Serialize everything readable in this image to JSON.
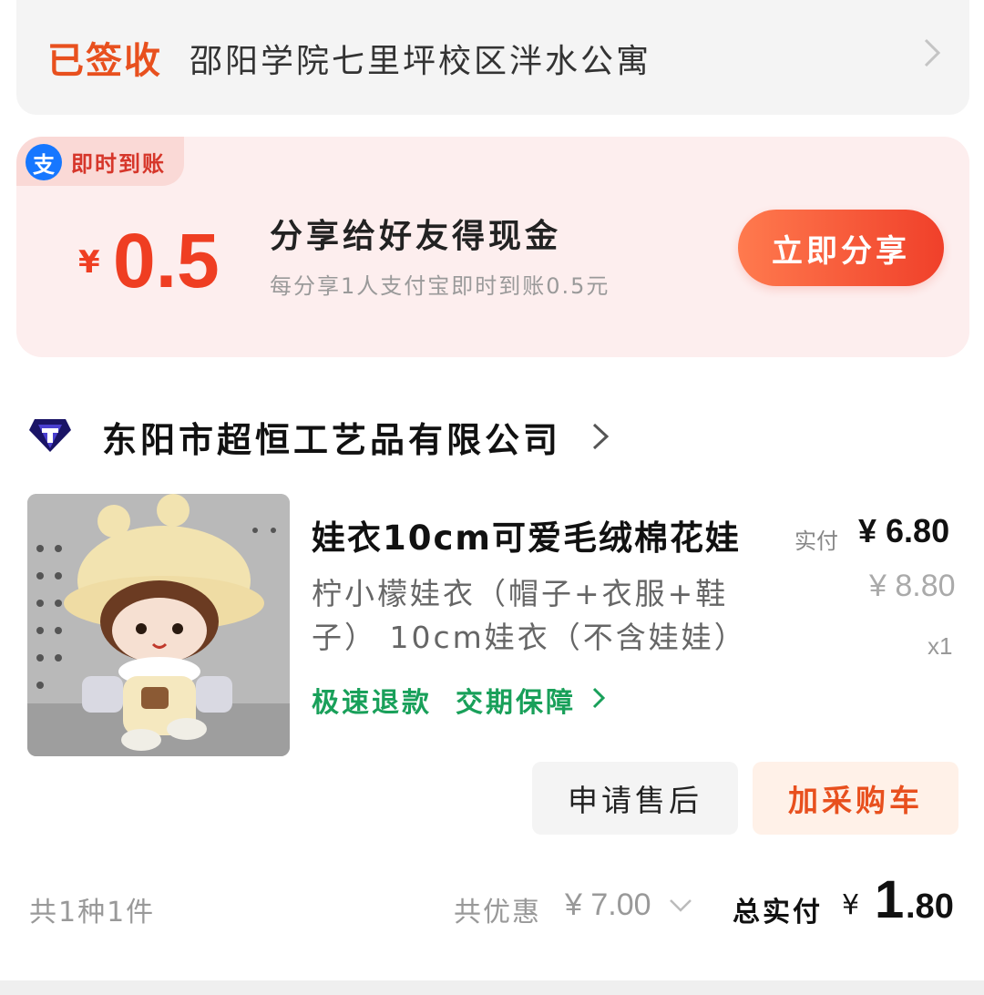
{
  "address": {
    "status": "已签收",
    "text": "邵阳学院七里坪校区泮水公寓"
  },
  "cashback": {
    "tag_icon": "支",
    "tag_text": "即时到账",
    "currency": "¥",
    "amount": "0.5",
    "title": "分享给好友得现金",
    "subtitle": "每分享1人支付宝即时到账0.5元",
    "button": "立即分享",
    "colors": {
      "accent": "#ef3e22",
      "background": "#fdeeee"
    }
  },
  "shop": {
    "name": "东阳市超恒工艺品有限公司",
    "icon": "shop-badge-icon"
  },
  "product": {
    "title": "娃衣10cm可爱毛绒棉花娃",
    "spec": "柠小檬娃衣（帽子+衣服+鞋子） 10cm娃衣（不含娃娃）",
    "price_label": "实付",
    "price_now": "¥ 6.80",
    "price_original": "¥ 8.80",
    "quantity": "x1",
    "services": [
      "极速退款",
      "交期保障"
    ],
    "service_color": "#19a05a"
  },
  "actions": {
    "after_sale": "申请售后",
    "add_to_cart": "加采购车"
  },
  "summary": {
    "count": "共1种1件",
    "discount_label": "共优惠",
    "discount_value": "¥ 7.00",
    "total_label": "总实付",
    "total_currency": "¥",
    "total_integer": "1",
    "total_decimal": ".80"
  }
}
